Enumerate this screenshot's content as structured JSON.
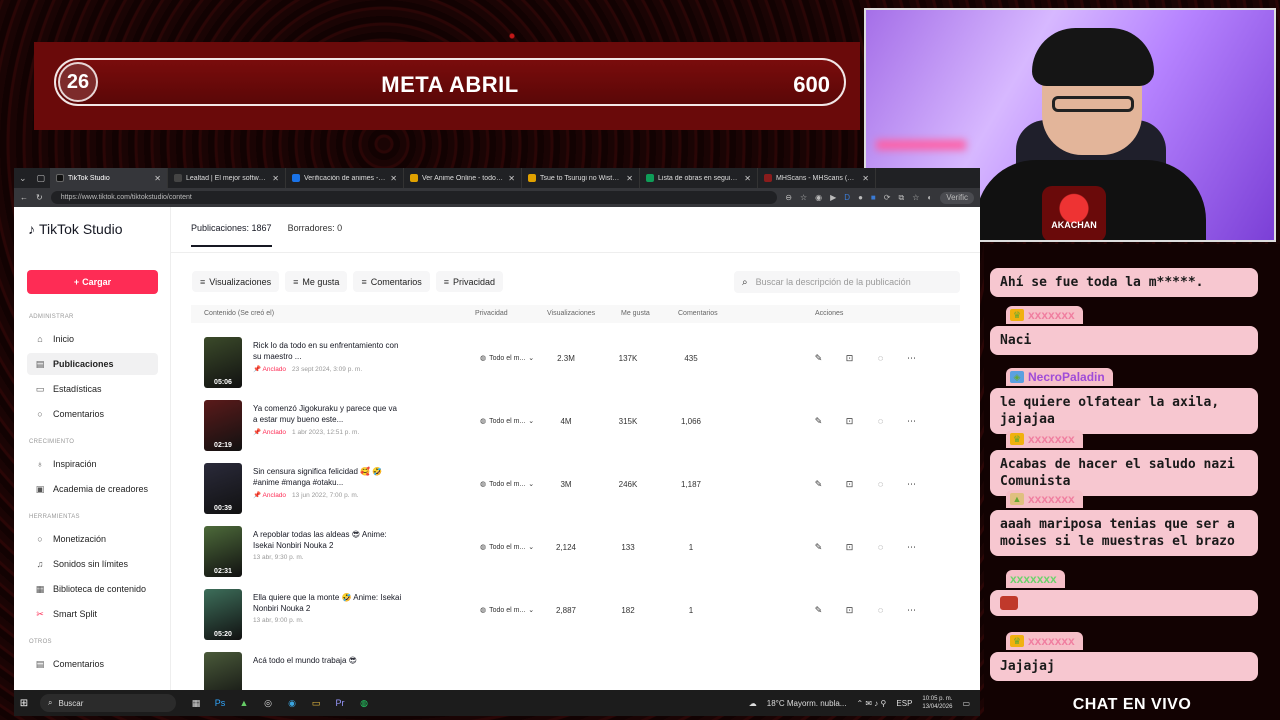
{
  "goal": {
    "start": "26",
    "title": "META ABRIL",
    "end": "600"
  },
  "webcam": {
    "badge_text": "AKACHAN"
  },
  "chat": {
    "messages": [
      {
        "user": "",
        "text": "Ahí se fue toda la m*****."
      },
      {
        "user": "xxxxxxx",
        "text": "Naci"
      },
      {
        "user": "NecroPaladin",
        "text": "le quiere olfatear la axila, jajajaa"
      },
      {
        "user": "xxxxxxx",
        "text": "Acabas de hacer el saludo nazi Comunista"
      },
      {
        "user": "xxxxxxx",
        "text": "aaah mariposa tenias que ser a moises si le muestras el brazo"
      },
      {
        "user": "xxxxxxx",
        "text": ""
      },
      {
        "user": "xxxxxxx",
        "text": "Jajajaj"
      }
    ],
    "footer": "CHAT EN VIVO"
  },
  "browser": {
    "tabs": [
      {
        "label": "TikTok Studio",
        "color": "#000000",
        "active": true
      },
      {
        "label": "Lealtad | El mejor software para p",
        "color": "#2c2c2c",
        "active": false
      },
      {
        "label": "Verificación de animes - Verificac",
        "color": "#1a73e8",
        "active": false
      },
      {
        "label": "Ver Anime Online - todos los ani",
        "color": "#e0a100",
        "active": false
      },
      {
        "label": "Tsue to Tsurugi no Wistoria Seas",
        "color": "#e0a100",
        "active": false
      },
      {
        "label": "Lista de obras en seguimiento - I",
        "color": "#0f9d58",
        "active": false
      },
      {
        "label": "MHScans - MHScans (Oficial)",
        "color": "#8a1c1c",
        "active": false
      }
    ],
    "url": "https://www.tiktok.com/tiktokstudio/content",
    "verif": "Verific"
  },
  "studio": {
    "logo": "TikTok Studio",
    "upload": "Cargar",
    "sections": {
      "admin": "ADMINISTRAR",
      "growth": "CRECIMIENTO",
      "tools": "HERRAMIENTAS",
      "others": "OTROS"
    },
    "nav": {
      "home": "Inicio",
      "posts": "Publicaciones",
      "stats": "Estadísticas",
      "comments": "Comentarios",
      "inspiration": "Inspiración",
      "academy": "Academia de creadores",
      "monetization": "Monetización",
      "sounds": "Sonidos sin límites",
      "library": "Biblioteca de contenido",
      "split": "Smart Split",
      "comments2": "Comentarios"
    },
    "top_tabs": {
      "posts": "Publicaciones: 1867",
      "drafts": "Borradores: 0"
    },
    "filters": {
      "views": "Visualizaciones",
      "likes": "Me gusta",
      "comments": "Comentarios",
      "privacy": "Privacidad"
    },
    "search_placeholder": "Buscar la descripción de la publicación",
    "columns": {
      "content": "Contenido (Se creó el)",
      "privacy": "Privacidad",
      "views": "Visualizaciones",
      "likes": "Me gusta",
      "comments": "Comentarios",
      "actions": "Acciones"
    },
    "rows": [
      {
        "title": "Rick lo da todo en su enfrentamiento con su maestro ...",
        "pinned": "Anclado",
        "date": "23 sept 2024, 3:09 p. m.",
        "privacy": "Todo el m...",
        "views": "2.3M",
        "likes": "137K",
        "comments": "435",
        "duration": "05:06",
        "thumb": "#3b4a2a"
      },
      {
        "title": "Ya comenzó Jigokuraku y parece que va a estar muy bueno este...",
        "pinned": "Anclado",
        "date": "1 abr 2023, 12:51 p. m.",
        "privacy": "Todo el m...",
        "views": "4M",
        "likes": "315K",
        "comments": "1,066",
        "duration": "02:19",
        "thumb": "#5a1a1a"
      },
      {
        "title": "Sin censura significa felicidad 🥰 🤣 #anime #manga #otaku...",
        "pinned": "Anclado",
        "date": "13 jun 2022, 7:00 p. m.",
        "privacy": "Todo el m...",
        "views": "3M",
        "likes": "246K",
        "comments": "1,187",
        "duration": "00:39",
        "thumb": "#2a2a3a"
      },
      {
        "title": "A repoblar todas las aldeas 😎 Anime: Isekai Nonbiri Nouka 2",
        "pinned": "",
        "date": "13 abr, 9:30 p. m.",
        "privacy": "Todo el m...",
        "views": "2,124",
        "likes": "133",
        "comments": "1",
        "duration": "02:31",
        "thumb": "#4d6a3a"
      },
      {
        "title": "Ella quiere que la monte 🤣 Anime: Isekai Nonbiri Nouka 2",
        "pinned": "",
        "date": "13 abr, 9:00 p. m.",
        "privacy": "Todo el m...",
        "views": "2,887",
        "likes": "182",
        "comments": "1",
        "duration": "05:20",
        "thumb": "#3d6e5a"
      },
      {
        "title": "Acá todo el mundo trabaja 😎",
        "pinned": "",
        "date": "",
        "privacy": "",
        "views": "",
        "likes": "",
        "comments": "",
        "duration": "",
        "thumb": "#4a5a3a"
      }
    ]
  },
  "taskbar": {
    "search": "Buscar",
    "weather": "18°C  Mayorm. nubla...",
    "lang": "ESP",
    "time": "10:05 p. m.",
    "date": "13/04/2026"
  }
}
